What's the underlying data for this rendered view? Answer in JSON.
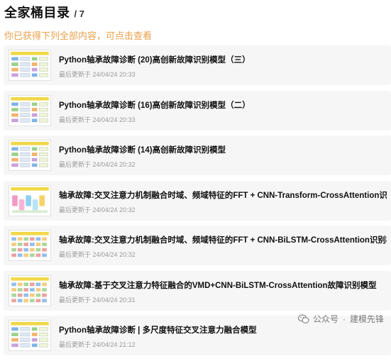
{
  "header": {
    "title": "全家桶目录",
    "count": "/ 7"
  },
  "notice": "你已获得下列全部内容，可点击查看",
  "meta_prefix": "最后更新于",
  "items": [
    {
      "title": "Python轴承故障诊断 (20)高创新故障识别模型（三）",
      "updated": "24/04/24 20:33",
      "thumb_style": "flow"
    },
    {
      "title": "Python轴承故障诊断 (16)高创新故障识别模型（二）",
      "updated": "24/04/24 20:33",
      "thumb_style": "flow"
    },
    {
      "title": "Python轴承故障诊断 (14)高创新故障识别模型",
      "updated": "24/04/24 20:32",
      "thumb_style": "flow"
    },
    {
      "title": "轴承故障:交叉注意力机制融合时域、频域特征的FFT + CNN-Transform-CrossAttention识别模型",
      "updated": "24/04/24 20:32",
      "thumb_style": "cubes"
    },
    {
      "title": "轴承故障:交叉注意力机制融合时域、频域特征的FFT + CNN-BiLSTM-CrossAttention识别模型",
      "updated": "24/04/24 20:32",
      "thumb_style": "bars"
    },
    {
      "title": "轴承故障:基于交叉注意力特征融合的VMD+CNN-BiLSTM-CrossAttention故障识别模型",
      "updated": "24/04/24 20:31",
      "thumb_style": "bars"
    },
    {
      "title": "Python轴承故障诊断 | 多尺度特征交叉注意力融合模型",
      "updated": "24/04/24 21:12",
      "thumb_style": "flow"
    }
  ],
  "watermark": {
    "platform": "公众号",
    "separator": "·",
    "account": "建模先锋"
  },
  "colors": {
    "notice": "#e8a14a",
    "card_bg": "#f6f6f6",
    "meta": "#9a9a9a"
  }
}
